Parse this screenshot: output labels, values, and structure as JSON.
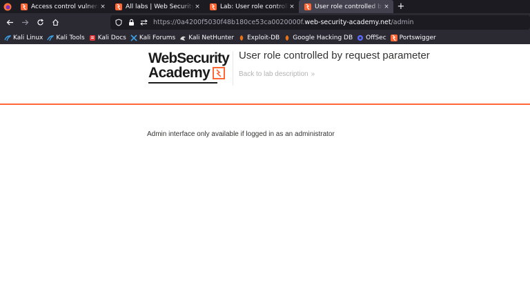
{
  "tabs": [
    {
      "label": "Access control vulnerabili",
      "active": false
    },
    {
      "label": "All labs | Web Security Ac",
      "active": false
    },
    {
      "label": "Lab: User role controlled b",
      "active": false
    },
    {
      "label": "User role controlled by re",
      "active": true
    }
  ],
  "tab_close_glyph": "×",
  "new_tab_glyph": "+",
  "url": {
    "scheme": "https://",
    "subdomain": "0a4200f5030f48b180ce53ca0020000f.",
    "domain": "web-security-academy.net",
    "path": "/admin"
  },
  "bookmarks": [
    {
      "label": "Kali Linux",
      "icon": "kali-dragon-icon",
      "color": "#3ea0e6"
    },
    {
      "label": "Kali Tools",
      "icon": "kali-dragon-icon",
      "color": "#3ea0e6"
    },
    {
      "label": "Kali Docs",
      "icon": "kali-docs-icon",
      "color": "#e03a3a"
    },
    {
      "label": "Kali Forums",
      "icon": "kali-forums-icon",
      "color": "#3ea0e6"
    },
    {
      "label": "Kali NetHunter",
      "icon": "nethunter-icon",
      "color": "#d9d9d9"
    },
    {
      "label": "Exploit-DB",
      "icon": "exploit-db-icon",
      "color": "#e8741a"
    },
    {
      "label": "Google Hacking DB",
      "icon": "ghdb-icon",
      "color": "#e8741a"
    },
    {
      "label": "OffSec",
      "icon": "offsec-icon",
      "color": "#5b6bff"
    },
    {
      "label": "Portswigger",
      "icon": "portswigger-icon",
      "color": "#ff6633"
    }
  ],
  "page": {
    "logo_line1": "WebSecurity",
    "logo_line2": "Academy",
    "title": "User role controlled by request parameter",
    "back_link": "Back to lab description",
    "back_chevron": "»",
    "message": "Admin interface only available if logged in as an administrator"
  },
  "colors": {
    "accent": "#ff6633",
    "tab_bg": "#1c1b22",
    "toolbar_bg": "#2b2a33"
  }
}
